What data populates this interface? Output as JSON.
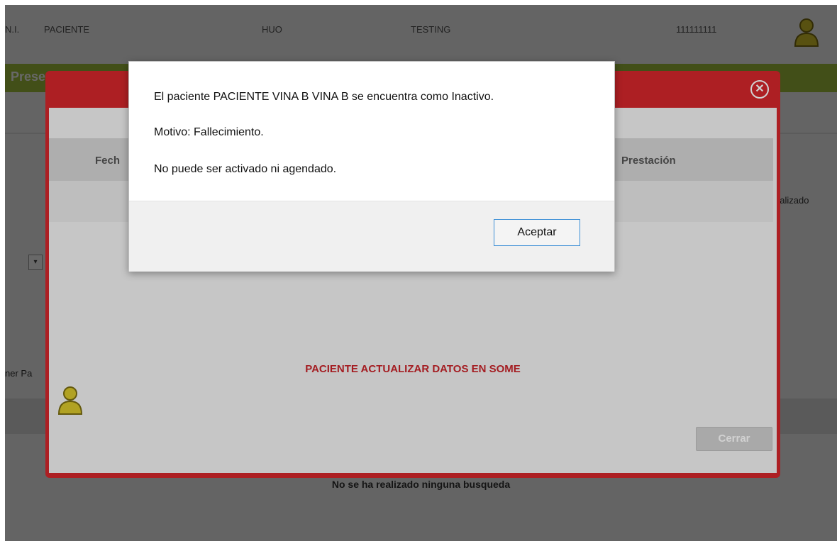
{
  "background": {
    "topbar": {
      "id_label": "N.I.",
      "patient_label": "PACIENTE",
      "hospital": "HUO",
      "environment": "TESTING",
      "phone": "111111111",
      "user_icon": "user-icon"
    },
    "section_title": "Presen",
    "table_partial_label": "ealizado",
    "left_partial_label": "ner Pa",
    "empty_message": "No se ha realizado ninguna busqueda"
  },
  "patient_modal": {
    "close_icon": "close-circle-icon",
    "columns": [
      "Fech",
      "Prestación"
    ],
    "warning": "PACIENTE ACTUALIZAR DATOS EN SOME",
    "close_label": "Cerrar",
    "accent_color": "#d3272b"
  },
  "alert_dialog": {
    "line1": "El paciente PACIENTE VINA B VINA B se encuentra como Inactivo.",
    "line2": "Motivo: Fallecimiento.",
    "line3": "No puede ser activado ni agendado.",
    "accept_label": "Aceptar"
  },
  "colors": {
    "brand_green": "#a3c23c",
    "alert_red": "#c8242a",
    "button_focus": "#3c8fd6",
    "user_icon_yellow": "#d8c62b"
  }
}
